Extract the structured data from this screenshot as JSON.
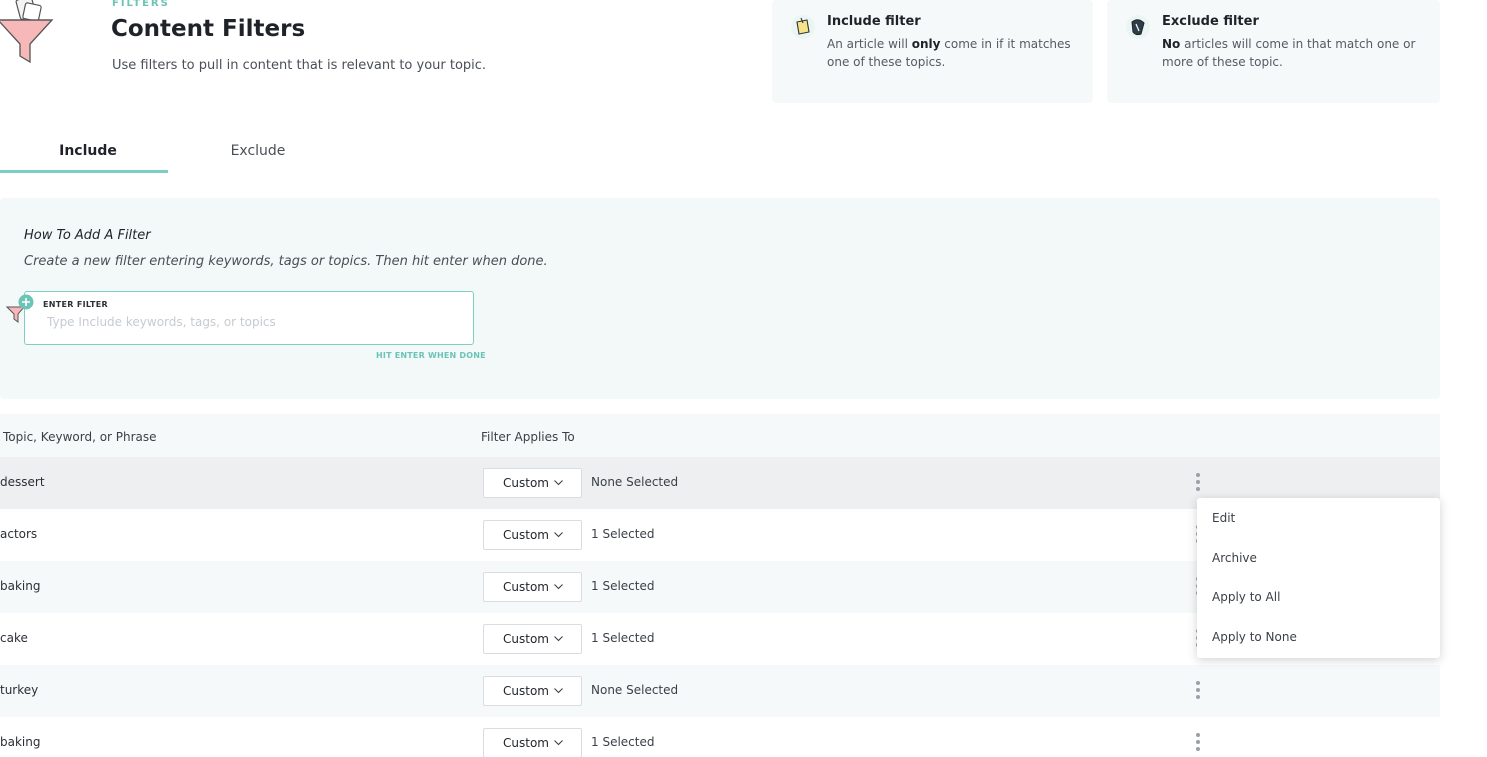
{
  "header": {
    "eyebrow": "FILTERS",
    "title": "Content Filters",
    "subtitle": "Use filters to pull in content that is relevant to your topic."
  },
  "cards": {
    "include": {
      "title": "Include filter",
      "text_before": "An article will ",
      "text_bold": "only",
      "text_after": " come in if it matches one of these topics."
    },
    "exclude": {
      "title": "Exclude filter",
      "text_bold": "No",
      "text_after": " articles will come in that match one or more of these topic."
    }
  },
  "tabs": [
    {
      "label": "Include",
      "active": true
    },
    {
      "label": "Exclude",
      "active": false
    }
  ],
  "howto": {
    "title": "How To Add A Filter",
    "description": "Create a new filter entering keywords, tags or topics. Then hit enter when done.",
    "field_label": "ENTER FILTER",
    "placeholder": "Type Include keywords, tags, or topics",
    "hint": "HIT ENTER WHEN DONE"
  },
  "table": {
    "headers": [
      "Topic, Keyword, or Phrase",
      "Filter Applies To"
    ],
    "rows": [
      {
        "keyword": "dessert",
        "applies": "Custom",
        "selection": "None Selected"
      },
      {
        "keyword": "actors",
        "applies": "Custom",
        "selection": "1 Selected"
      },
      {
        "keyword": "baking",
        "applies": "Custom",
        "selection": "1 Selected"
      },
      {
        "keyword": "cake",
        "applies": "Custom",
        "selection": "1 Selected"
      },
      {
        "keyword": "turkey",
        "applies": "Custom",
        "selection": "None Selected"
      },
      {
        "keyword": "baking",
        "applies": "Custom",
        "selection": "1 Selected"
      }
    ]
  },
  "context_menu": {
    "items": [
      "Edit",
      "Archive",
      "Apply to All",
      "Apply to None"
    ]
  },
  "colors": {
    "accent": "#7ecfc2",
    "panel": "#f3f8f9"
  }
}
